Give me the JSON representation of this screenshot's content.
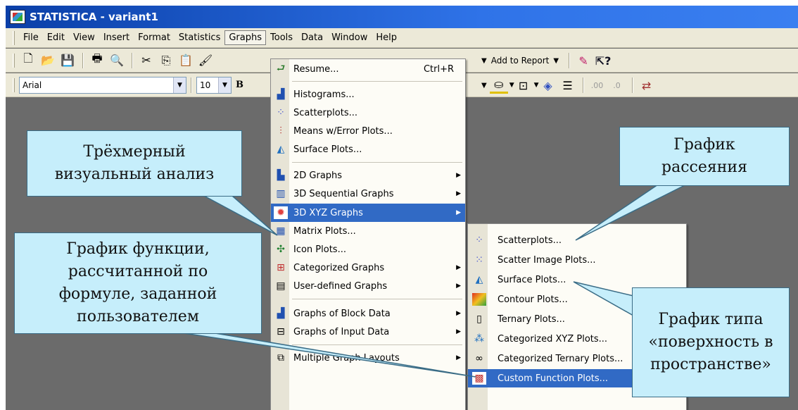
{
  "window": {
    "title": "STATISTICA - variant1"
  },
  "menubar": {
    "items": [
      "File",
      "Edit",
      "View",
      "Insert",
      "Format",
      "Statistics",
      "Graphs",
      "Tools",
      "Data",
      "Window",
      "Help"
    ],
    "active": "Graphs"
  },
  "toolbar": {
    "add_to_report": "Add to Report",
    "font_name": "Arial",
    "font_size": "10",
    "bold": "B"
  },
  "graphs_menu": {
    "resume": {
      "label": "Resume...",
      "shortcut": "Ctrl+R"
    },
    "histograms": "Histograms...",
    "scatterplots": "Scatterplots...",
    "means_error": "Means w/Error Plots...",
    "surface": "Surface Plots...",
    "g2d": "2D Graphs",
    "seq3d": "3D Sequential Graphs",
    "xyz3d": "3D XYZ Graphs",
    "matrix": "Matrix Plots...",
    "icon": "Icon Plots...",
    "categorized": "Categorized Graphs",
    "user_defined": "User-defined Graphs",
    "block": "Graphs of Block Data",
    "input": "Graphs of Input Data",
    "multiple": "Multiple Graph Layouts"
  },
  "xyz_submenu": {
    "scatterplots": "Scatterplots...",
    "scatter_image": "Scatter Image Plots...",
    "surface": "Surface Plots...",
    "contour": "Contour Plots...",
    "ternary": "Ternary Plots...",
    "cat_xyz": "Categorized XYZ Plots...",
    "cat_ternary": "Categorized Ternary Plots...",
    "custom_function": "Custom Function Plots..."
  },
  "callouts": {
    "three_d": "Трёхмерный\nвизуальный анализ",
    "scatter": "График\nрассеяния",
    "function": "График функции,\nрассчитанной по\nформуле, заданной\nпользователем",
    "surface": "График типа\n«поверхность в\nпространстве»"
  },
  "colors": {
    "title_bar": "#0a3fa8",
    "highlight": "#316ac5",
    "callout_fill": "#c6eefb",
    "workspace": "#6b6b6b"
  }
}
